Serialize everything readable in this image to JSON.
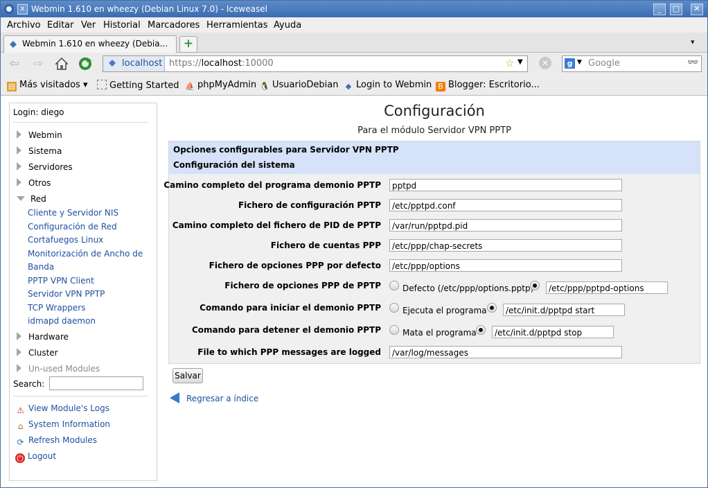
{
  "window": {
    "title": "Webmin 1.610 en wheezy (Debian Linux 7.0) - Iceweasel",
    "pin_label": "x"
  },
  "menu": [
    "Archivo",
    "Editar",
    "Ver",
    "Historial",
    "Marcadores",
    "Herramientas",
    "Ayuda"
  ],
  "tab": {
    "label": "Webmin 1.610 en wheezy (Debia..."
  },
  "nav": {
    "site_label": "localhost",
    "url_prefix": "https://",
    "url_host": "localhost",
    "url_port": ":10000",
    "search_placeholder": "Google"
  },
  "bookmarks": [
    "Más visitados",
    "Getting Started",
    "phpMyAdmin",
    "UsuarioDebian",
    "Login to Webmin",
    "Blogger: Escritorio..."
  ],
  "sidebar": {
    "login": "Login: diego",
    "categories_top": [
      "Webmin",
      "Sistema",
      "Servidores",
      "Otros"
    ],
    "open_category": "Red",
    "modules": [
      "Cliente y Servidor NIS",
      "Configuración de Red",
      "Cortafuegos Linux",
      "Monitorización de Ancho de Banda",
      "PPTP VPN Client",
      "Servidor VPN PPTP",
      "TCP Wrappers",
      "idmapd daemon"
    ],
    "categories_bottom": [
      "Hardware",
      "Cluster"
    ],
    "unused": "Un-used Modules",
    "search_label": "Search:",
    "actions": [
      "View Module's Logs",
      "System Information",
      "Refresh Modules",
      "Logout"
    ]
  },
  "page": {
    "title": "Configuración",
    "subtitle": "Para el módulo Servidor VPN PPTP",
    "header1": "Opciones configurables para Servidor VPN PPTP",
    "header2": "Configuración del sistema",
    "rows": [
      {
        "label": "Camino completo del programa demonio PPTP",
        "value": "pptpd"
      },
      {
        "label": "Fichero de configuración PPTP",
        "value": "/etc/pptpd.conf"
      },
      {
        "label": "Camino completo del fichero de PID de PPTP",
        "value": "/var/run/pptpd.pid"
      },
      {
        "label": "Fichero de cuentas PPP",
        "value": "/etc/ppp/chap-secrets"
      },
      {
        "label": "Fichero de opciones PPP por defecto",
        "value": "/etc/ppp/options"
      }
    ],
    "radio_rows": [
      {
        "label": "Fichero de opciones PPP de PPTP",
        "option_label": "Defecto (/etc/ppp/options.pptp)",
        "value": "/etc/ppp/pptpd-options"
      },
      {
        "label": "Comando para iniciar el demonio PPTP",
        "option_label": "Ejecuta el programa",
        "value": "/etc/init.d/pptpd start"
      },
      {
        "label": "Comando para detener el demonio PPTP",
        "option_label": "Mata el programa",
        "value": "/etc/init.d/pptpd stop"
      }
    ],
    "last_row": {
      "label": "File to which PPP messages are logged",
      "value": "/var/log/messages"
    },
    "save": "Salvar",
    "back": "Regresar a índice"
  }
}
